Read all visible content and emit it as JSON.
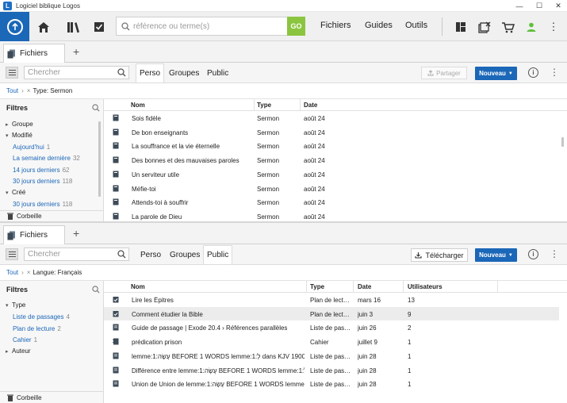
{
  "window": {
    "title": "Logiciel biblique Logos"
  },
  "toolbar": {
    "search_placeholder": "référence ou terme(s)",
    "go_label": "GO",
    "links": [
      "Fichiers",
      "Guides",
      "Outils"
    ]
  },
  "colors": {
    "accent": "#1b67b8",
    "go": "#8bc53f"
  },
  "panel1": {
    "tab_label": "Fichiers",
    "search_placeholder": "Chercher",
    "segments": [
      "Perso",
      "Groupes",
      "Public"
    ],
    "active_segment": "Perso",
    "share_label": "Partager",
    "new_label": "Nouveau",
    "breadcrumb": {
      "home": "Tout",
      "filter": "Type: Sermon"
    },
    "filters": {
      "header": "Filtres",
      "items": [
        {
          "label": "Groupe",
          "type": "collapsed"
        },
        {
          "label": "Modifié",
          "type": "expanded"
        },
        {
          "label": "Aujourd'hui",
          "count": "1",
          "type": "link"
        },
        {
          "label": "La semaine dernière",
          "count": "32",
          "type": "link"
        },
        {
          "label": "14 jours derniers",
          "count": "62",
          "type": "link"
        },
        {
          "label": "30 jours derniers",
          "count": "118",
          "type": "link"
        },
        {
          "label": "Créé",
          "type": "expanded"
        },
        {
          "label": "30 jours derniers",
          "count": "118",
          "type": "link"
        }
      ],
      "trash": "Corbeille"
    },
    "columns": [
      "Nom",
      "Type",
      "Date"
    ],
    "rows": [
      {
        "name": "Sois fidèle",
        "type": "Sermon",
        "date": "août 24"
      },
      {
        "name": "De bon enseignants",
        "type": "Sermon",
        "date": "août 24"
      },
      {
        "name": "La souffrance et la vie éternelle",
        "type": "Sermon",
        "date": "août 24"
      },
      {
        "name": "Des bonnes et des mauvaises paroles",
        "type": "Sermon",
        "date": "août 24"
      },
      {
        "name": "Un serviteur utile",
        "type": "Sermon",
        "date": "août 24"
      },
      {
        "name": "Méfie-toi",
        "type": "Sermon",
        "date": "août 24"
      },
      {
        "name": "Attends-toi à souffrir",
        "type": "Sermon",
        "date": "août 24"
      },
      {
        "name": "La parole de Dieu",
        "type": "Sermon",
        "date": "août 24"
      }
    ]
  },
  "panel2": {
    "tab_label": "Fichiers",
    "search_placeholder": "Chercher",
    "segments": [
      "Perso",
      "Groupes",
      "Public"
    ],
    "active_segment": "Public",
    "download_label": "Télécharger",
    "new_label": "Nouveau",
    "breadcrumb": {
      "home": "Tout",
      "filter": "Langue: Français"
    },
    "filters": {
      "header": "Filtres",
      "items": [
        {
          "label": "Type",
          "type": "expanded"
        },
        {
          "label": "Liste de passages",
          "count": "4",
          "type": "link"
        },
        {
          "label": "Plan de lecture",
          "count": "2",
          "type": "link"
        },
        {
          "label": "Cahier",
          "count": "1",
          "type": "link"
        },
        {
          "label": "Auteur",
          "type": "collapsed"
        }
      ],
      "trash": "Corbeille"
    },
    "columns": [
      "Nom",
      "Type",
      "Date",
      "Utilisateurs"
    ],
    "rows": [
      {
        "name": "Lire les Épitres",
        "type": "Plan de lect…",
        "date": "mars 16",
        "users": "13",
        "icon": "plan"
      },
      {
        "name": "Comment étudier la Bible",
        "type": "Plan de lect…",
        "date": "juin 3",
        "users": "9",
        "icon": "plan"
      },
      {
        "name": "Guide de passage | Exode 20.4 › Références parallèles",
        "type": "Liste de pas…",
        "date": "juin 26",
        "users": "2",
        "icon": "list"
      },
      {
        "name": "prédication prison",
        "type": "Cahier",
        "date": "juillet 9",
        "users": "1",
        "icon": "notebook"
      },
      {
        "name": "lemme:1:עָשָׂה BEFORE 1 WORDS lemme:1:לְ dans KJV 1900…",
        "type": "Liste de pas…",
        "date": "juin 28",
        "users": "1",
        "icon": "list"
      },
      {
        "name": "Différence entre lemme:1:עָשָׂה BEFORE 1 WORDS lemme:1:לְ…",
        "type": "Liste de pas…",
        "date": "juin 28",
        "users": "1",
        "icon": "list"
      },
      {
        "name": "Union de Union de lemme:1:עָשָׂה BEFORE 1 WORDS lemme…",
        "type": "Liste de pas…",
        "date": "juin 28",
        "users": "1",
        "icon": "list"
      }
    ]
  }
}
